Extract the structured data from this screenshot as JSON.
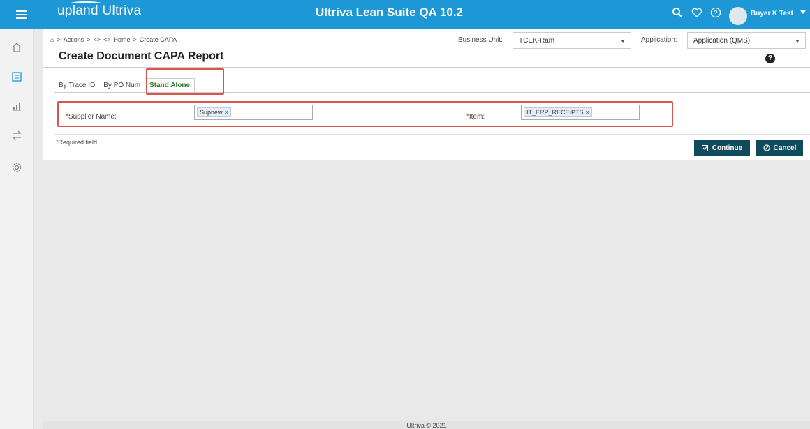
{
  "header": {
    "brand": "upland Ultriva",
    "app_title": "Ultriva Lean Suite QA 10.2",
    "user_name": "Buyer K Test",
    "icons": [
      "menu-icon",
      "search-icon",
      "heart-icon",
      "help-circle-icon",
      "avatar",
      "caret-down-icon"
    ]
  },
  "sidebar": {
    "items": [
      {
        "name": "home-icon",
        "glyph": "⌂"
      },
      {
        "name": "checklist-icon",
        "glyph": "☑"
      },
      {
        "name": "chart-icon",
        "glyph": "📈"
      },
      {
        "name": "swap-icon",
        "glyph": "⇄"
      },
      {
        "name": "gear-icon",
        "glyph": "⚙"
      }
    ]
  },
  "breadcrumb": {
    "home_icon": "⌂",
    "sep": ">",
    "actions": "Actions",
    "code1": "<>",
    "code2": "<>",
    "home": "Home",
    "current": "Create CAPA"
  },
  "page_title": "Create Document CAPA Report",
  "business_unit": {
    "label": "Business Unit:",
    "value": "TCEK-Ram"
  },
  "application": {
    "label": "Application:",
    "value": "Application (QMS)"
  },
  "help_glyph": "?",
  "tabs": [
    {
      "label": "By Trace ID",
      "active": false
    },
    {
      "label": "By PO Num",
      "active": false
    },
    {
      "label": "Stand Alone",
      "active": true
    }
  ],
  "form": {
    "supplier_label": "Supplier Name:",
    "supplier_tag": "Supnew",
    "item_label": "Item:",
    "item_tag": "IT_ERP_RECEIPTS",
    "required_mark": "*",
    "remove_glyph": "×"
  },
  "required_note": "Required field",
  "buttons": {
    "continue": "Continue",
    "cancel": "Cancel"
  },
  "footer": "Ultriva © 2021",
  "colors": {
    "header": "#1d97d5",
    "button": "#0f4a5d",
    "highlight": "#d9534f",
    "active_tab": "#2e7a2e"
  }
}
